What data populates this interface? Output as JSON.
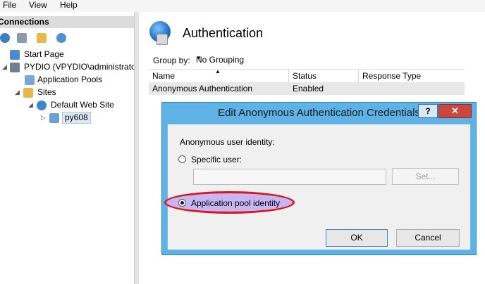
{
  "menu": [
    "File",
    "View",
    "Help"
  ],
  "connections": {
    "header": "Connections",
    "tree": [
      {
        "label": "Start Page"
      },
      {
        "label": "PYDIO (VPYDIO\\administrato"
      },
      {
        "label": "Application Pools"
      },
      {
        "label": "Sites"
      },
      {
        "label": "Default Web Site"
      },
      {
        "label": "py608"
      }
    ]
  },
  "feature": {
    "title": "Authentication",
    "group_by_label": "Group by:",
    "group_by_value": "No Grouping",
    "columns": [
      "Name",
      "Status",
      "Response Type"
    ],
    "rows": [
      {
        "name": "Anonymous Authentication",
        "status": "Enabled",
        "response_type": ""
      }
    ]
  },
  "dialog": {
    "title": "Edit Anonymous Authentication Credentials",
    "help": "?",
    "close": "✕",
    "identity_label": "Anonymous user identity:",
    "specific_user_label": "Specific user:",
    "specific_user_value": "",
    "set_button": "Set...",
    "app_pool_label": "Application pool identity",
    "selected_option": "Application pool identity",
    "ok_button": "OK",
    "cancel_button": "Cancel"
  }
}
